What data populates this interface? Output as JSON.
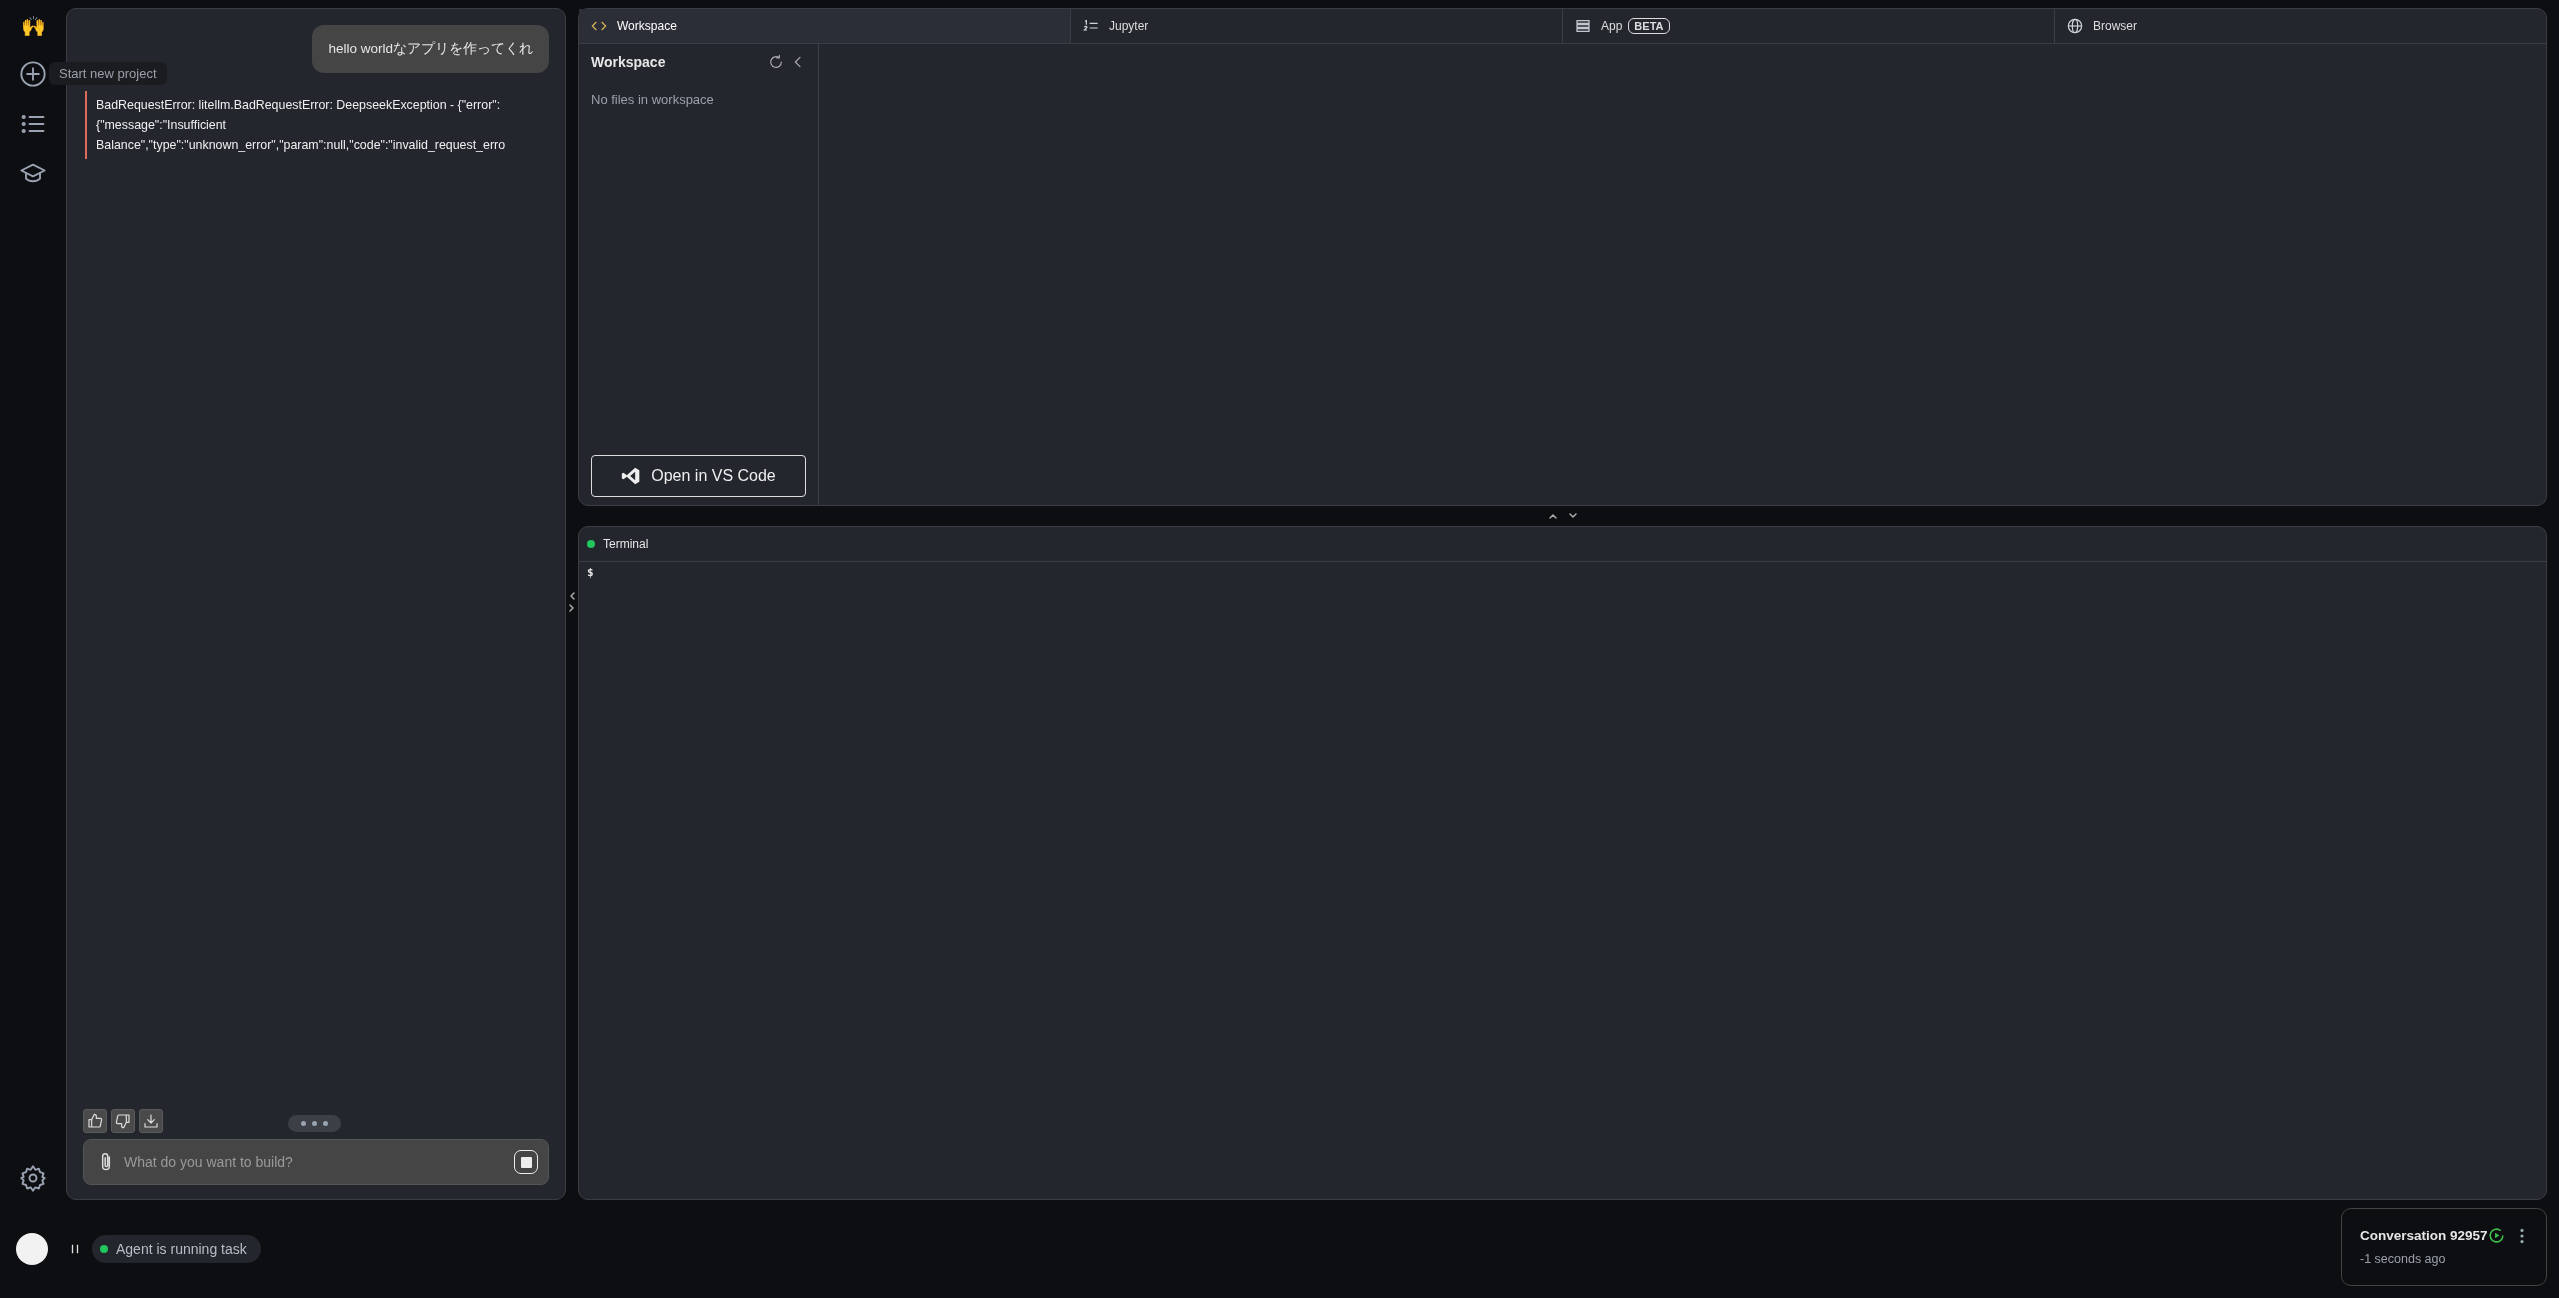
{
  "sidebar": {
    "logo": "🙌",
    "tooltip": "Start new project"
  },
  "chat": {
    "messages": [
      {
        "kind": "user",
        "text": "hello worldなアプリを作ってくれ"
      },
      {
        "kind": "error",
        "text": "BadRequestError: litellm.BadRequestError: DeepseekException - {\"error\":{\"message\":\"Insufficient Balance\",\"type\":\"unknown_error\",\"param\":null,\"code\":\"invalid_request_erro"
      }
    ],
    "input": {
      "placeholder": "What do you want to build?"
    }
  },
  "status": {
    "text": "Agent is running task",
    "running": true
  },
  "tabs": [
    {
      "kind": "code",
      "label": "Workspace",
      "selected": true
    },
    {
      "kind": "jupyter",
      "label": "Jupyter",
      "selected": false
    },
    {
      "kind": "app",
      "label": "App",
      "badge": "BETA",
      "selected": false
    },
    {
      "kind": "browser",
      "label": "Browser",
      "selected": false
    }
  ],
  "workspace": {
    "title": "Workspace",
    "empty": "No files in workspace",
    "button": "Open in VS Code"
  },
  "terminal": {
    "title": "Terminal",
    "prompt": "$"
  },
  "conversation": {
    "title": "Conversation 92957",
    "time": "-1 seconds ago"
  }
}
